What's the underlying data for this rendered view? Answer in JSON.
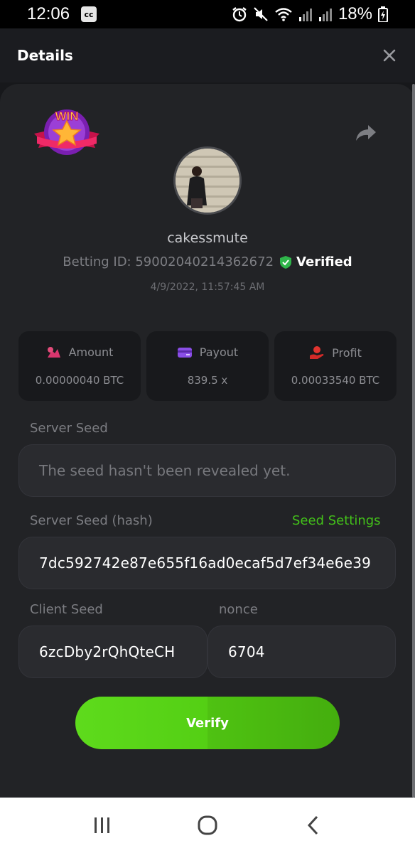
{
  "status_bar": {
    "time": "12:06",
    "app_icon_text": "cc",
    "battery_percent": "18%",
    "icons": [
      "alarm-icon",
      "mute-icon",
      "wifi-icon",
      "signal-icon",
      "signal-icon",
      "battery-icon"
    ]
  },
  "header": {
    "title": "Details",
    "close_icon": "close-icon"
  },
  "badge": {
    "text": "WIN",
    "icon": "star-icon"
  },
  "share_icon": "share-icon",
  "user": {
    "username": "cakessmute",
    "betting_id": "Betting ID: 590020402143626​72",
    "verified": "Verified",
    "timestamp": "4/9/2022, 11:57:45 AM"
  },
  "stats": [
    {
      "label": "Amount",
      "value": "0.00000040 BTC",
      "icon": "coins-icon"
    },
    {
      "label": "Payout",
      "value": "839.5 x",
      "icon": "card-icon"
    },
    {
      "label": "Profit",
      "value": "0.00033540 BTC",
      "icon": "hand-coin-icon"
    }
  ],
  "server_seed": {
    "label": "Server Seed",
    "placeholder": "The seed hasn't been revealed yet."
  },
  "server_seed_hash": {
    "label": "Server Seed (hash)",
    "link": "Seed Settings",
    "value": "7dc592742e87e655f16ad0ecaf5d7ef34e6e39"
  },
  "client_seed": {
    "label": "Client Seed",
    "value": "6zcDby2rQhQteCH"
  },
  "nonce": {
    "label": "nonce",
    "value": "6704"
  },
  "verify_button": {
    "label": "Verify"
  },
  "colors": {
    "accent": "#4fc41a",
    "background": "#17181b",
    "panel": "#222326"
  }
}
